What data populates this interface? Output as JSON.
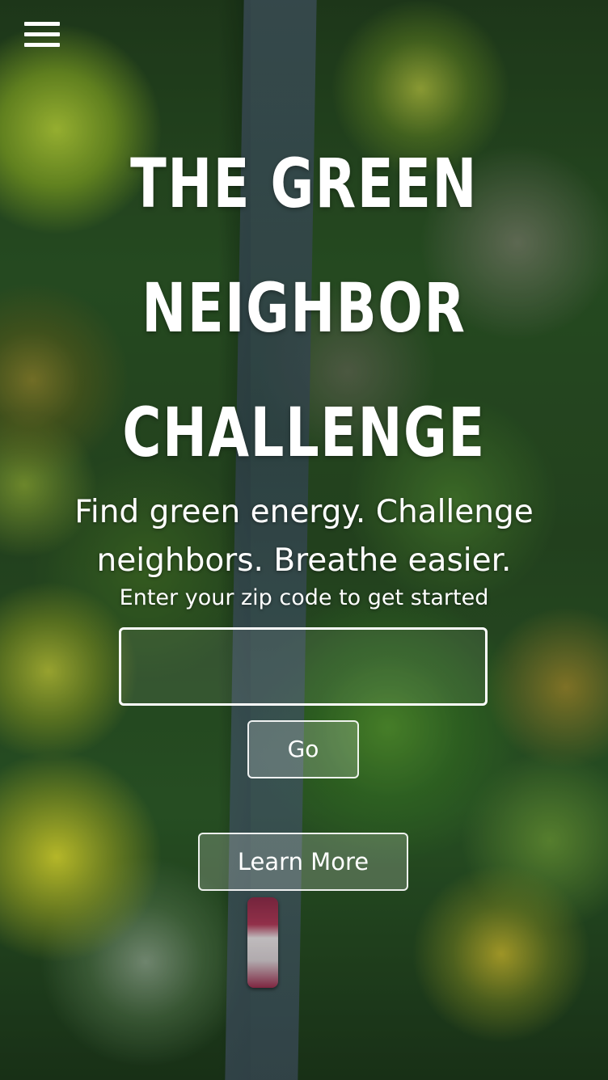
{
  "background": {
    "image_subject": "aerial-forest-road",
    "colors": {
      "forest_dark": "#24431f",
      "forest_bright": "#b8d43c",
      "road": "#4b5f70",
      "car": "#b23b5a"
    }
  },
  "header": {
    "menu_icon": "hamburger-menu-icon"
  },
  "hero": {
    "title_lines": [
      "THE GREEN",
      "NEIGHBOR",
      "CHALLENGE"
    ],
    "tagline_line1": "Find green energy. Challenge",
    "tagline_line2": "neighbors. Breathe easier.",
    "zip_prompt": "Enter your zip code to get started"
  },
  "zip_form": {
    "value": "",
    "placeholder": "",
    "go_label": "Go"
  },
  "learn_more_label": "Learn More",
  "colors": {
    "text": "#ffffff",
    "button_border": "#ffffff"
  }
}
